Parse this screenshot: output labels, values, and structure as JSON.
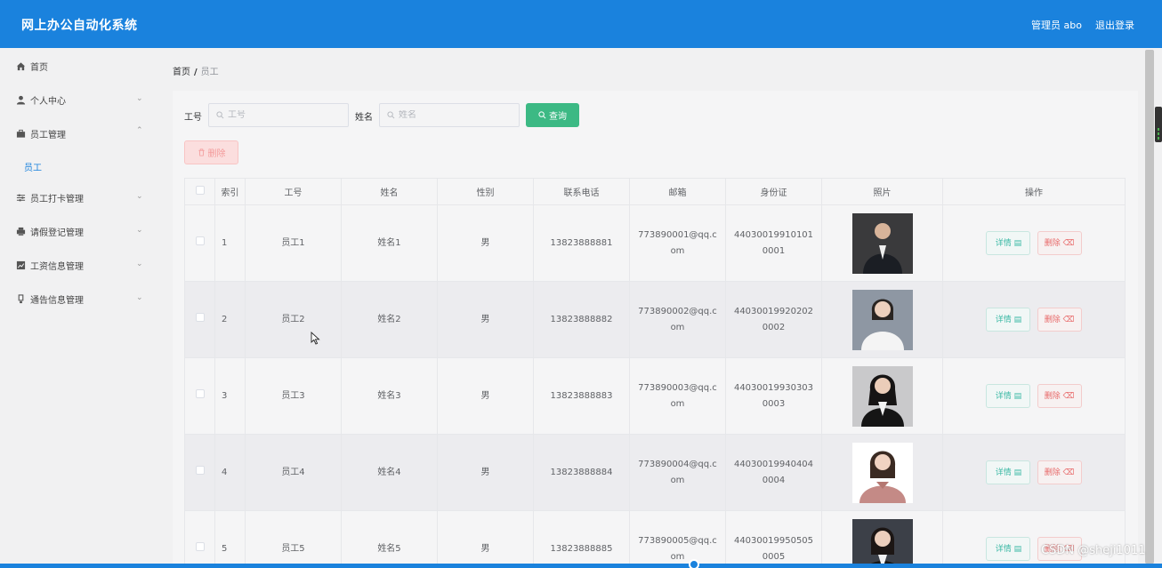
{
  "app": {
    "title": "网上办公自动化系统",
    "user": "管理员 abo",
    "logout": "退出登录"
  },
  "sidebar": {
    "items": [
      {
        "label": "首页",
        "icon": "home-icon",
        "chevron": ""
      },
      {
        "label": "个人中心",
        "icon": "user-icon",
        "chevron": "down"
      },
      {
        "label": "员工管理",
        "icon": "briefcase-icon",
        "chevron": "up"
      },
      {
        "label": "员工打卡管理",
        "icon": "sliders-icon",
        "chevron": "down"
      },
      {
        "label": "请假登记管理",
        "icon": "printer-icon",
        "chevron": "down"
      },
      {
        "label": "工资信息管理",
        "icon": "chart-icon",
        "chevron": "down"
      },
      {
        "label": "通告信息管理",
        "icon": "bulb-icon",
        "chevron": "down"
      }
    ],
    "subitem": "员工"
  },
  "breadcrumb": {
    "home": "首页",
    "sep": "/",
    "current": "员工"
  },
  "filters": {
    "employee_no_label": "工号",
    "employee_no_placeholder": "工号",
    "name_label": "姓名",
    "name_placeholder": "姓名",
    "search_button": "查询",
    "delete_button": "删除"
  },
  "table": {
    "headers": [
      "索引",
      "工号",
      "姓名",
      "性别",
      "联系电话",
      "邮箱",
      "身份证",
      "照片",
      "操作"
    ],
    "rows": [
      {
        "idx": "1",
        "no": "员工1",
        "name": "姓名1",
        "gender": "男",
        "phone": "13823888881",
        "email": "773890001@qq.com",
        "id": "440300199101010001"
      },
      {
        "idx": "2",
        "no": "员工2",
        "name": "姓名2",
        "gender": "男",
        "phone": "13823888882",
        "email": "773890002@qq.com",
        "id": "440300199202020002"
      },
      {
        "idx": "3",
        "no": "员工3",
        "name": "姓名3",
        "gender": "男",
        "phone": "13823888883",
        "email": "773890003@qq.com",
        "id": "440300199303030003"
      },
      {
        "idx": "4",
        "no": "员工4",
        "name": "姓名4",
        "gender": "男",
        "phone": "13823888884",
        "email": "773890004@qq.com",
        "id": "440300199404040004"
      },
      {
        "idx": "5",
        "no": "员工5",
        "name": "姓名5",
        "gender": "男",
        "phone": "13823888885",
        "email": "773890005@qq.com",
        "id": "440300199505050005"
      }
    ],
    "detail_label": "详情",
    "delete_label": "删除"
  },
  "watermark": "CSDN @sheji1011",
  "colors": {
    "accent": "#1a82dd",
    "success": "#3cb984",
    "danger": "#e86a6a"
  }
}
